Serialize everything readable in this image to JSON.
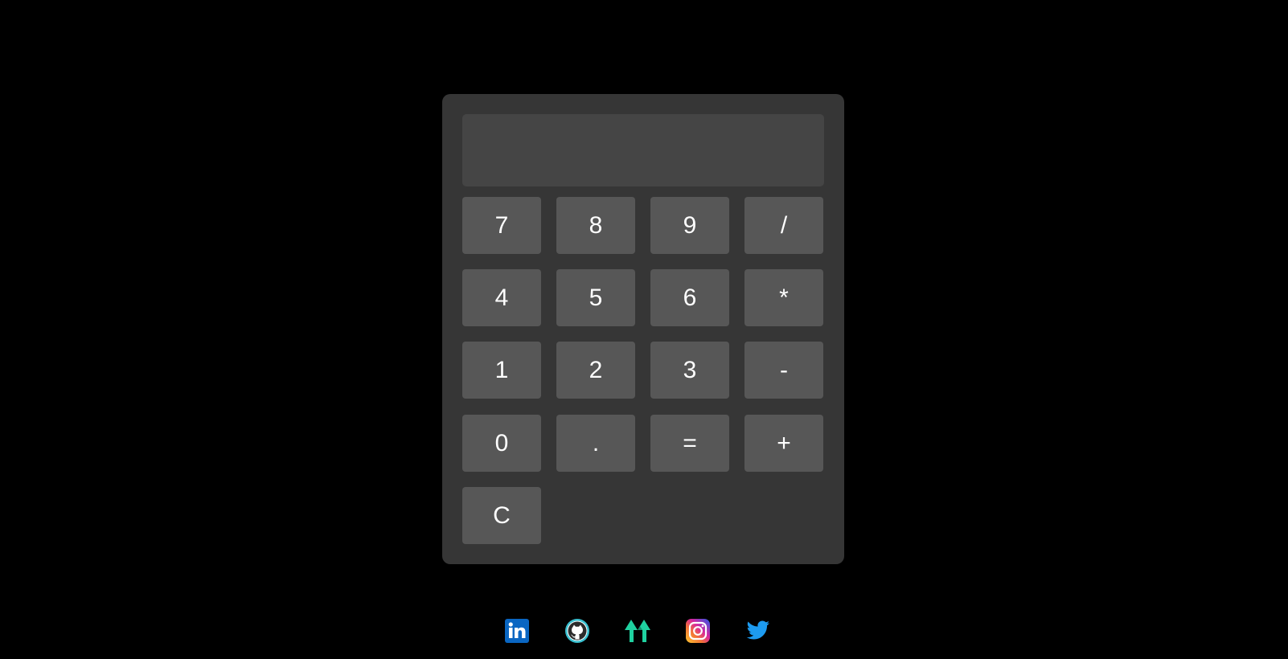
{
  "calculator": {
    "display_value": "",
    "keys": [
      "7",
      "8",
      "9",
      "/",
      "4",
      "5",
      "6",
      "*",
      "1",
      "2",
      "3",
      "-",
      "0",
      ".",
      "=",
      "+",
      "C"
    ]
  },
  "social_links": [
    {
      "icon": "linkedin-icon",
      "color": "#0a66c2"
    },
    {
      "icon": "github-icon",
      "color": "#39c0d0"
    },
    {
      "icon": "upwork-icon",
      "color": "#1fd1a0"
    },
    {
      "icon": "instagram-icon",
      "color": "#d6249f"
    },
    {
      "icon": "twitter-icon",
      "color": "#1d9bf0"
    }
  ],
  "colors": {
    "background": "#000000",
    "panel": "#363636",
    "display": "#454545",
    "key": "#575757",
    "key_text": "#ffffff"
  }
}
